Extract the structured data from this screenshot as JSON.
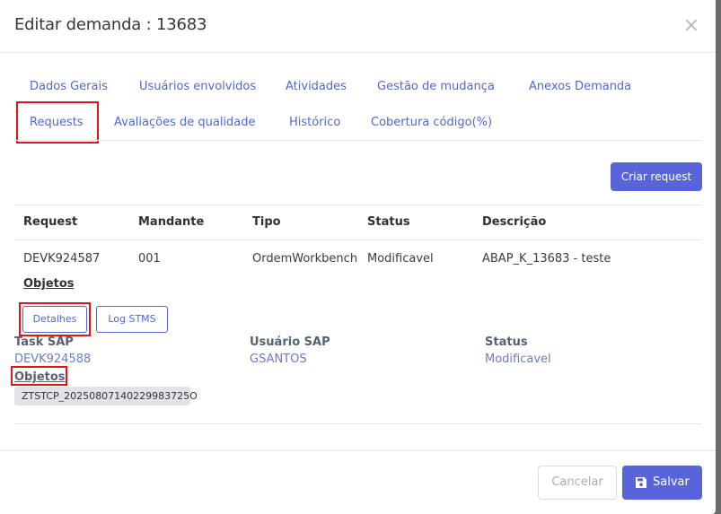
{
  "modal": {
    "title": "Editar demanda : 13683",
    "close_symbol": "×"
  },
  "tabs": [
    {
      "label": "Dados Gerais"
    },
    {
      "label": "Usuários envolvidos"
    },
    {
      "label": "Atividades"
    },
    {
      "label": "Gestão de mudança"
    },
    {
      "label": "Anexos Demanda"
    },
    {
      "label": "Requests",
      "active": true
    },
    {
      "label": "Avaliações de qualidade"
    },
    {
      "label": "Histórico"
    },
    {
      "label": "Cobertura código(%)"
    }
  ],
  "toolbar": {
    "create_request_label": "Criar request"
  },
  "table": {
    "headers": [
      "Request",
      "Mandante",
      "Tipo",
      "Status",
      "Descrição"
    ],
    "rows": [
      [
        "DEVK924587",
        "001",
        "OrdemWorkbench",
        "Modificavel",
        "ABAP_K_13683 - teste"
      ]
    ]
  },
  "objects_link": "Objetos",
  "actions": {
    "details_label": "Detalhes",
    "log_label": "Log STMS"
  },
  "details": {
    "task_label": "Task SAP",
    "task_value": "DEVK924588",
    "user_label": "Usuário SAP",
    "user_value": "GSANTOS",
    "status_label": "Status",
    "status_value": "Modificavel",
    "objects_label": "Objetos",
    "object_chip": "ZTSTCP_20250807140229983725O"
  },
  "footer": {
    "cancel_label": "Cancelar",
    "save_label": "Salvar"
  },
  "colors": {
    "accent": "#5864d9",
    "highlight": "#e01515"
  },
  "icons": {
    "close": "close-icon",
    "save": "save-icon"
  }
}
